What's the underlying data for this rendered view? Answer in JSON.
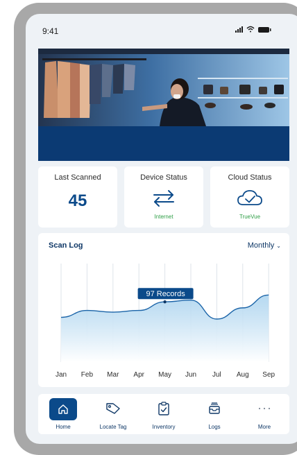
{
  "status_bar": {
    "time": "9:41"
  },
  "stats": {
    "last_scanned": {
      "label": "Last Scanned",
      "value": "45"
    },
    "device_status": {
      "label": "Device Status",
      "icon": "transfer-arrows-icon",
      "sub": "Internet"
    },
    "cloud_status": {
      "label": "Cloud Status",
      "icon": "cloud-check-icon",
      "sub": "TrueVue"
    }
  },
  "scan_log": {
    "title": "Scan Log",
    "period": "Monthly",
    "tooltip": "97 Records"
  },
  "chart_data": {
    "type": "area",
    "x": [
      "Jan",
      "Feb",
      "Mar",
      "Apr",
      "May",
      "Jun",
      "Jul",
      "Aug",
      "Sep"
    ],
    "values": [
      52,
      60,
      58,
      60,
      70,
      72,
      50,
      63,
      78
    ],
    "highlight": {
      "x": "May",
      "label": "97 Records"
    },
    "grid": "vertical",
    "colors": {
      "line": "#1b64a8",
      "fill_top": "#a9d2ee",
      "fill_bottom": "#ffffff",
      "grid": "#dde3ea"
    }
  },
  "nav": {
    "items": [
      {
        "label": "Home",
        "icon": "home-icon",
        "active": true
      },
      {
        "label": "Locate Tag",
        "icon": "tag-icon",
        "active": false
      },
      {
        "label": "Inventory",
        "icon": "clipboard-icon",
        "active": false
      },
      {
        "label": "Logs",
        "icon": "inbox-tray-icon",
        "active": false
      },
      {
        "label": "More",
        "icon": "more-dots-icon",
        "active": false
      }
    ]
  },
  "colors": {
    "brand": "#0b4a8a",
    "success": "#2e9e46",
    "background": "#eef2f6"
  }
}
